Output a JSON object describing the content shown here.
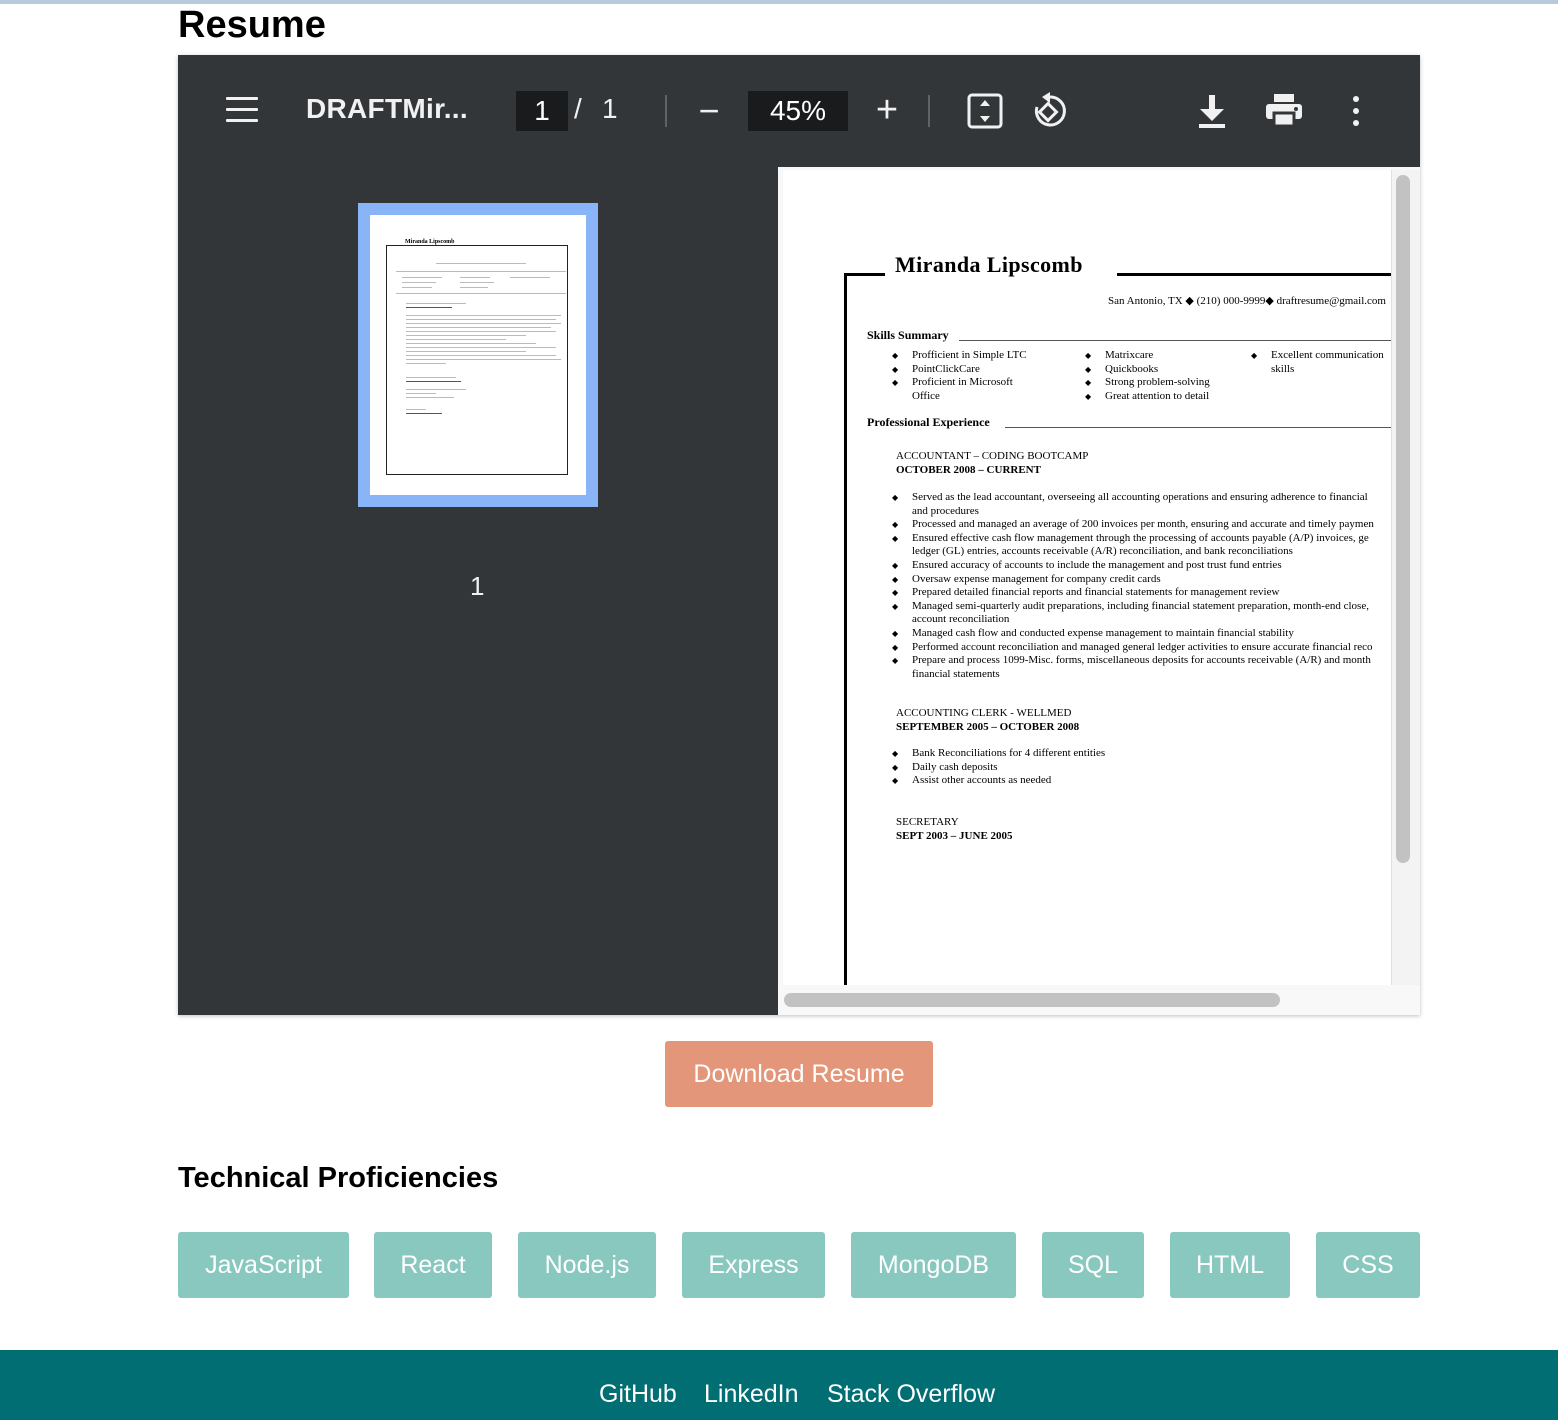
{
  "page": {
    "title": "Resume"
  },
  "viewer": {
    "doc_title": "DRAFTMir...",
    "current_page": "1",
    "page_separator": "/",
    "total_pages": "1",
    "zoom_out": "−",
    "zoom": "45%",
    "zoom_in": "+",
    "thumbnail_label": "1",
    "icons": [
      "menu-icon",
      "fit-page-icon",
      "rotate-icon",
      "download-icon",
      "print-icon",
      "more-options-icon"
    ],
    "colors": {
      "toolbar": "#323639",
      "thumbnail_highlight": "#8ab4f8"
    }
  },
  "resume": {
    "name": "Miranda Lipscomb",
    "contact": "San Antonio, TX ◆ (210) 000-9999◆ draftresume@gmail.com",
    "skills_heading": "Skills Summary",
    "skills": [
      [
        "Profficient in Simple LTC",
        "PointClickCare",
        "Proficient in Microsoft Office"
      ],
      [
        "Matrixcare",
        "Quickbooks",
        "Strong problem-solving",
        "Great attention to detail"
      ],
      [
        "Excellent communication skills"
      ]
    ],
    "experience_heading": "Professional Experience",
    "jobs": [
      {
        "title": "ACCOUNTANT – CODING BOOTCAMP",
        "dates": "OCTOBER 2008 – CURRENT",
        "bullets": [
          "Served as the lead accountant, overseeing all accounting operations and ensuring adherence to financial",
          "and procedures",
          "Processed and managed an average of 200 invoices per month, ensuring and accurate and timely paymen",
          "Ensured effective cash flow management through the processing of accounts payable (A/P) invoices, ge",
          "ledger (GL) entries, accounts receivable (A/R) reconciliation, and bank reconciliations",
          "Ensured accuracy of accounts to include the management and post trust fund entries",
          "Oversaw expense management for company credit cards",
          "Prepared detailed financial reports and financial statements for management review",
          "Managed semi-quarterly audit preparations, including financial statement preparation, month-end close,",
          "account reconciliation",
          "Managed cash flow and conducted expense management to maintain financial stability",
          "Performed account reconciliation and managed general ledger activities to ensure accurate financial reco",
          "Prepare and process 1099-Misc. forms, miscellaneous deposits for accounts receivable (A/R) and month",
          "financial statements"
        ],
        "bullet_marks": [
          1,
          0,
          1,
          1,
          0,
          1,
          1,
          1,
          1,
          0,
          1,
          1,
          1,
          0
        ]
      },
      {
        "title": "ACCOUNTING CLERK - WELLMED",
        "dates": "SEPTEMBER 2005 – OCTOBER 2008",
        "bullets": [
          "Bank Reconciliations for 4 different entities",
          "Daily cash deposits",
          "Assist other accounts as needed"
        ],
        "bullet_marks": [
          1,
          1,
          1
        ]
      },
      {
        "title": "SECRETARY",
        "dates": "SEPT 2003 – JUNE 2005",
        "bullets": [],
        "bullet_marks": []
      }
    ]
  },
  "download_button": {
    "label": "Download Resume",
    "color": "#e39679"
  },
  "technical": {
    "heading": "Technical Proficiencies",
    "chips": [
      "JavaScript",
      "React",
      "Node.js",
      "Express",
      "MongoDB",
      "SQL",
      "HTML",
      "CSS"
    ],
    "chip_color": "#88c8bf"
  },
  "footer": {
    "links": [
      "GitHub",
      "LinkedIn",
      "Stack Overflow"
    ],
    "color": "#006e73"
  }
}
